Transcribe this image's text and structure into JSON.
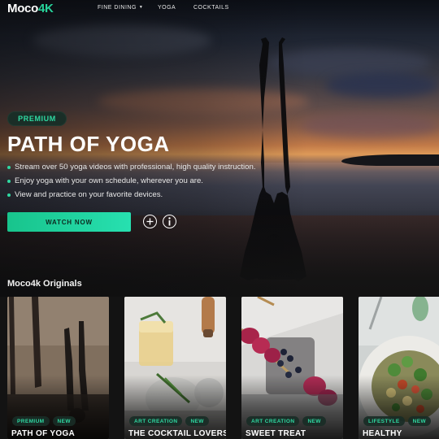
{
  "brand": {
    "logo_main": "Moco",
    "logo_accent": "4K",
    "accent_color": "#27d39a"
  },
  "nav": {
    "items": [
      {
        "label": "FINE DINING",
        "has_dropdown": true
      },
      {
        "label": "YOGA",
        "has_dropdown": false
      },
      {
        "label": "COCKTAILS",
        "has_dropdown": false
      }
    ]
  },
  "hero": {
    "badge": "PREMIUM",
    "title": "PATH OF YOGA",
    "features": [
      "Stream over 50 yoga videos with professional, high quality instruction.",
      "Enjoy yoga with your own schedule, wherever you are.",
      "View and practice on your favorite devices."
    ],
    "watch_label": "WATCH NOW",
    "add_icon": "plus-circle-icon",
    "info_icon": "info-circle-icon"
  },
  "originals": {
    "title": "Moco4k Originals",
    "cards": [
      {
        "tags": [
          "PREMIUM",
          "NEW"
        ],
        "title": "PATH OF YOGA",
        "image": "yoga-silhouette"
      },
      {
        "tags": [
          "ART CREATION",
          "NEW"
        ],
        "title": "THE COCKTAIL LOVERS",
        "image": "cocktail-glasses"
      },
      {
        "tags": [
          "ART CREATION",
          "NEW"
        ],
        "title": "SWEET TREAT",
        "image": "fruit-skewers"
      },
      {
        "tags": [
          "LIFESTYLE",
          "NEW"
        ],
        "title": "HEALTHY",
        "image": "salad-plate"
      }
    ]
  }
}
